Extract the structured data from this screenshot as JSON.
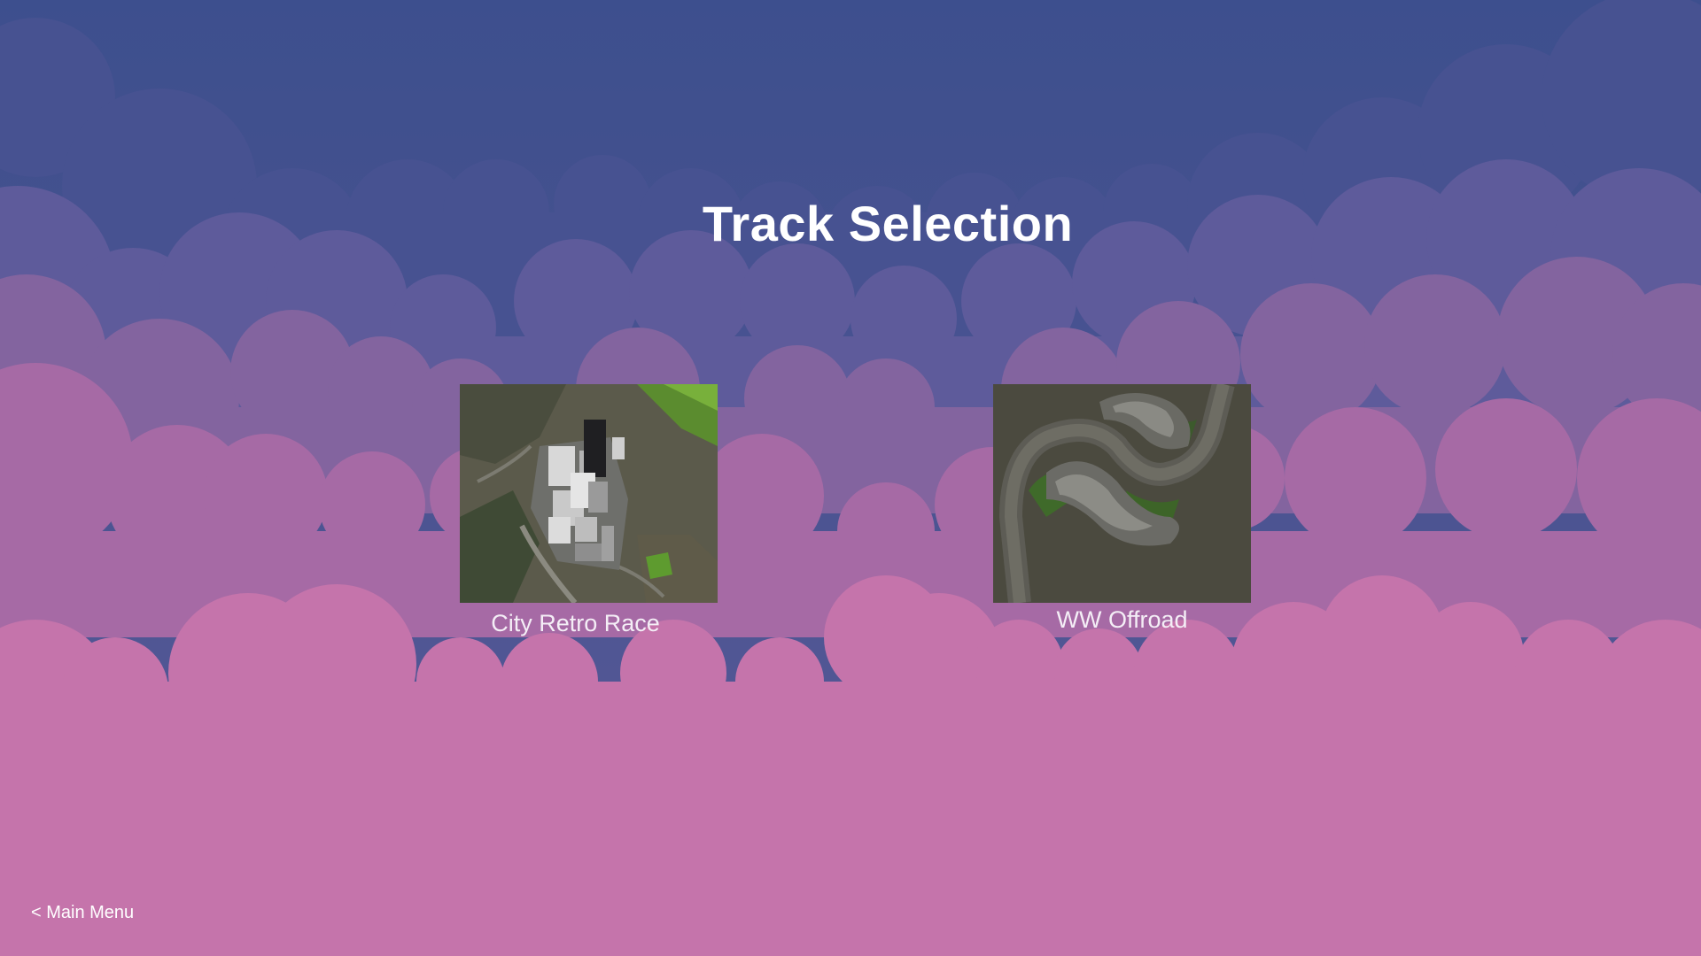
{
  "screen": {
    "title": "Track Selection",
    "colors": {
      "sky_top": "#3f5190",
      "sky_mid": "#7d639f",
      "clouds_front": "#c574ab",
      "text": "#ffffff"
    }
  },
  "tracks": [
    {
      "label": "City Retro Race",
      "thumbnail": "aerial-city-track-thumbnail"
    },
    {
      "label": "WW Offroad",
      "thumbnail": "aerial-offroad-track-thumbnail"
    }
  ],
  "navigation": {
    "back_label": "< Main Menu"
  }
}
